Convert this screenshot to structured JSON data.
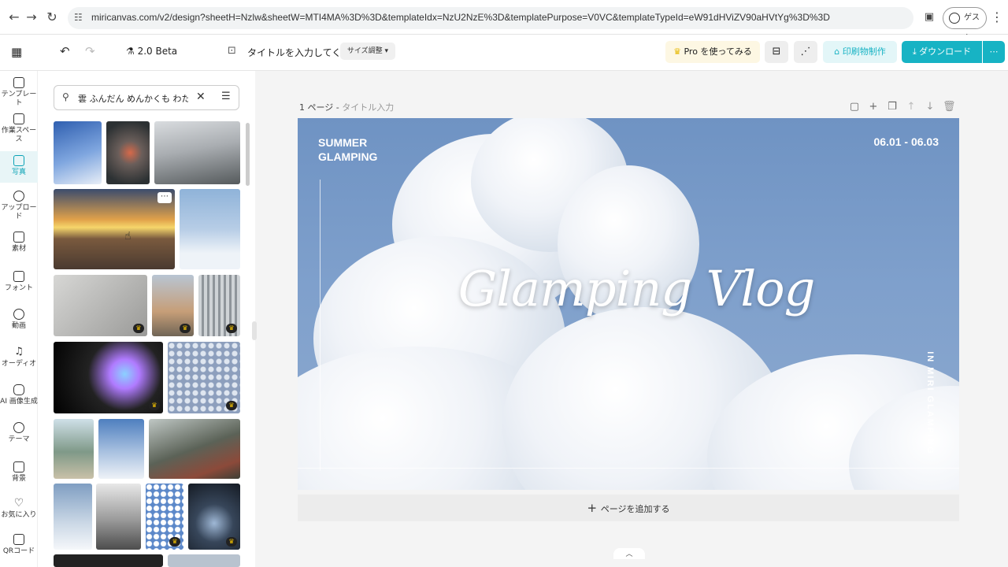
{
  "browser": {
    "url": "miricanvas.com/v2/design?sheetH=Nzlw&sheetW=MTI4MA%3D%3D&templateIdx=NzU2NzE%3D&templatePurpose=V0VC&templateTypeId=eW91dHViZV90aHVtYg%3D%3D",
    "guest_label": "ゲスト"
  },
  "toolbar": {
    "version": "2.0 Beta",
    "title_placeholder": "タイトルを入力してくた",
    "resize_label": "サイズ調整",
    "pro_label": "Pro を使ってみる",
    "print_label": "印刷物制作",
    "download_label": "ダウンロード",
    "more_label": "⋯"
  },
  "rail": {
    "items": [
      {
        "label": "テンプレート"
      },
      {
        "label": "作業スペース"
      },
      {
        "label": "写真"
      },
      {
        "label": "アップロード"
      },
      {
        "label": "素材"
      },
      {
        "label": "フォント"
      },
      {
        "label": "動画"
      },
      {
        "label": "オーディオ"
      },
      {
        "label": "AI 画像生成"
      },
      {
        "label": "テーマ"
      },
      {
        "label": "背景"
      },
      {
        "label": "お気に入り"
      },
      {
        "label": "QRコード"
      }
    ]
  },
  "panel": {
    "search_query": "雲 ふんだん めんかくも わた 雀",
    "more_icon": "⋯"
  },
  "canvas": {
    "page_number": "1 ページ",
    "page_title_placeholder": "タイトル入力",
    "add_page_label": "ページを追加する",
    "design": {
      "summer_line1": "SUMMER",
      "summer_line2": "GLAMPING",
      "dates": "06.01 - 06.03",
      "title": "Glamping Vlog",
      "vertical_text": "IN MIRI GLAMPING"
    }
  },
  "colors": {
    "accent": "#17b3c4",
    "pro_bg": "#fdf7e3",
    "sky": "#7a9cc8"
  }
}
